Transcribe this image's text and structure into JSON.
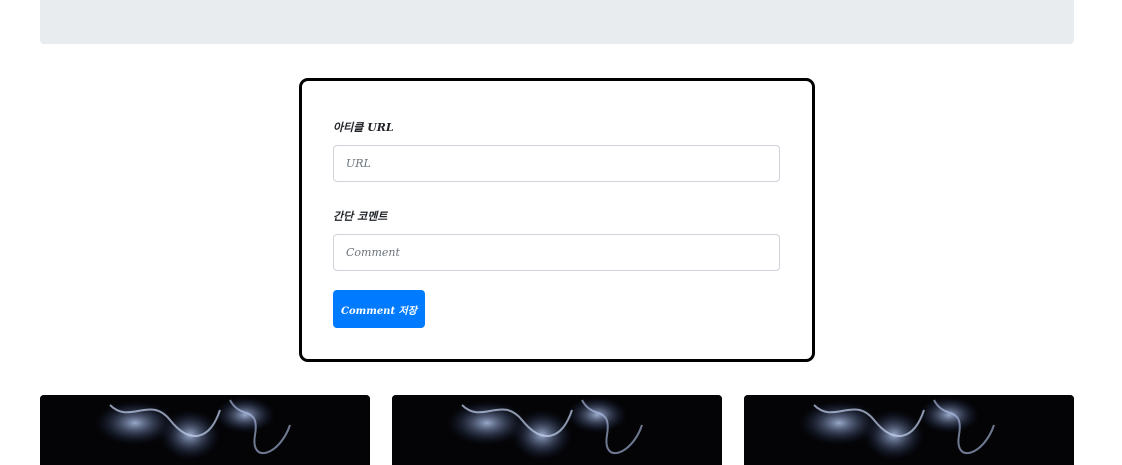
{
  "jumbotron": {},
  "post_box": {
    "url_label": "아티클 URL",
    "url_placeholder": "URL",
    "url_value": "",
    "comment_label": "간단 코멘트",
    "comment_placeholder": "Comment",
    "comment_value": "",
    "submit_label": "Comment 저장"
  },
  "cards": [
    {
      "image": "smoke-image"
    },
    {
      "image": "smoke-image"
    },
    {
      "image": "smoke-image"
    }
  ],
  "colors": {
    "accent": "#007bff",
    "jumbotron_bg": "#e9ecef",
    "box_border": "#000000"
  }
}
